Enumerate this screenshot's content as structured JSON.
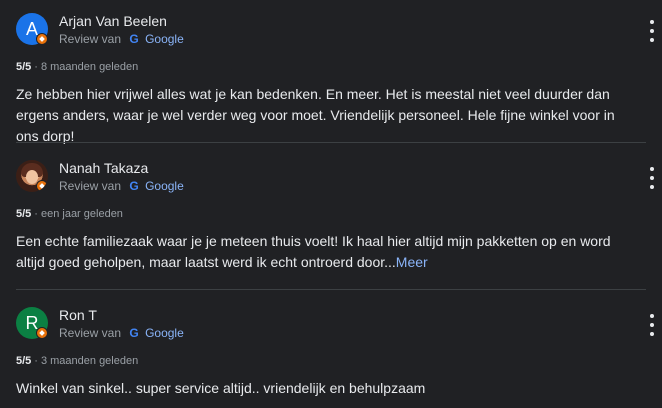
{
  "reviews": [
    {
      "initial": "A",
      "avatar_color": "#1a73e8",
      "name": "Arjan Van Beelen",
      "source_prefix": "Review van",
      "source_name": "Google",
      "rating": "5/5",
      "separator": "·",
      "time": "8 maanden geleden",
      "text": "Ze hebben hier vrijwel alles wat je kan bedenken. En meer. Het is meestal niet veel duurder dan ergens anders, waar je wel verder weg voor moet. Vriendelijk personeel. Hele fijne winkel voor in ons dorp!"
    },
    {
      "initial": "",
      "avatar_color": "",
      "name": "Nanah Takaza",
      "source_prefix": "Review van",
      "source_name": "Google",
      "rating": "5/5",
      "separator": "·",
      "time": "een jaar geleden",
      "text": "Een echte familiezaak waar je je meteen thuis voelt! Ik haal hier altijd mijn pakketten op en word altijd goed geholpen, maar laatst werd ik echt ontroerd door...",
      "more": "Meer"
    },
    {
      "initial": "R",
      "avatar_color": "#0b8043",
      "name": "Ron T",
      "source_prefix": "Review van",
      "source_name": "Google",
      "rating": "5/5",
      "separator": "·",
      "time": "3 maanden geleden",
      "text": "Winkel van sinkel.. super service altijd.. vriendelijk en behulpzaam"
    }
  ],
  "icons": {
    "more": "vertical-ellipsis",
    "google": "G",
    "local_guide": "local-guide-badge"
  }
}
